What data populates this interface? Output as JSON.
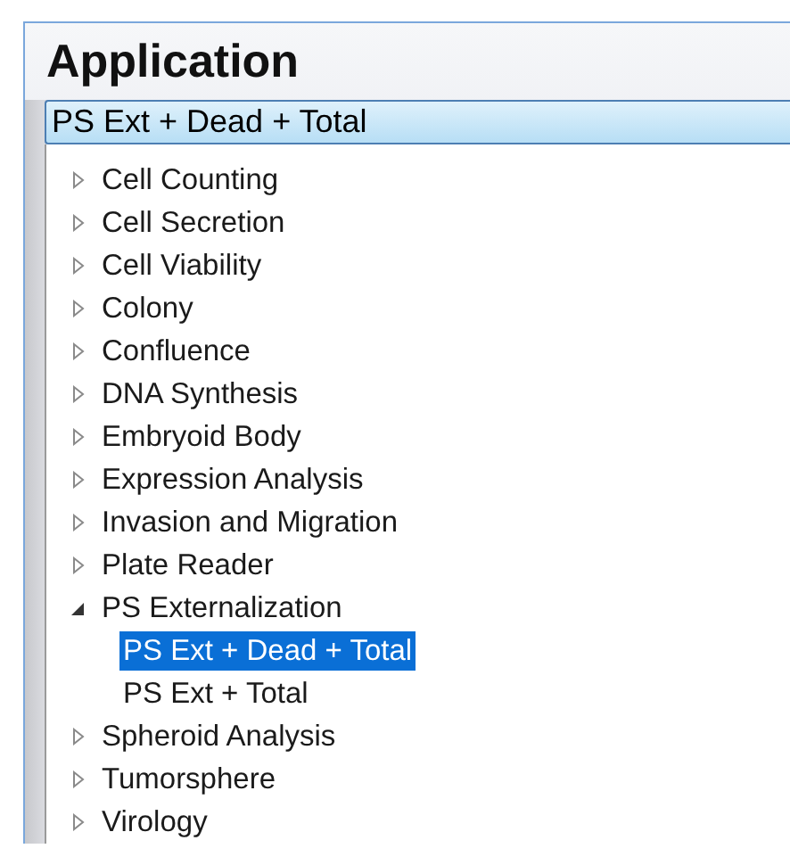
{
  "title": "Application",
  "combo": {
    "value": "PS Ext + Dead + Total"
  },
  "tree": [
    {
      "label": "Cell Counting",
      "expanded": false,
      "selected": false
    },
    {
      "label": "Cell Secretion",
      "expanded": false,
      "selected": false
    },
    {
      "label": "Cell Viability",
      "expanded": false,
      "selected": false
    },
    {
      "label": "Colony",
      "expanded": false,
      "selected": false
    },
    {
      "label": "Confluence",
      "expanded": false,
      "selected": false
    },
    {
      "label": "DNA Synthesis",
      "expanded": false,
      "selected": false
    },
    {
      "label": "Embryoid Body",
      "expanded": false,
      "selected": false
    },
    {
      "label": "Expression Analysis",
      "expanded": false,
      "selected": false
    },
    {
      "label": "Invasion and Migration",
      "expanded": false,
      "selected": false
    },
    {
      "label": "Plate Reader",
      "expanded": false,
      "selected": false
    },
    {
      "label": "PS Externalization",
      "expanded": true,
      "selected": false,
      "children": [
        {
          "label": "PS Ext + Dead + Total",
          "selected": true
        },
        {
          "label": "PS Ext + Total",
          "selected": false
        }
      ]
    },
    {
      "label": "Spheroid Analysis",
      "expanded": false,
      "selected": false
    },
    {
      "label": "Tumorsphere",
      "expanded": false,
      "selected": false
    },
    {
      "label": "Virology",
      "expanded": false,
      "selected": false
    }
  ]
}
